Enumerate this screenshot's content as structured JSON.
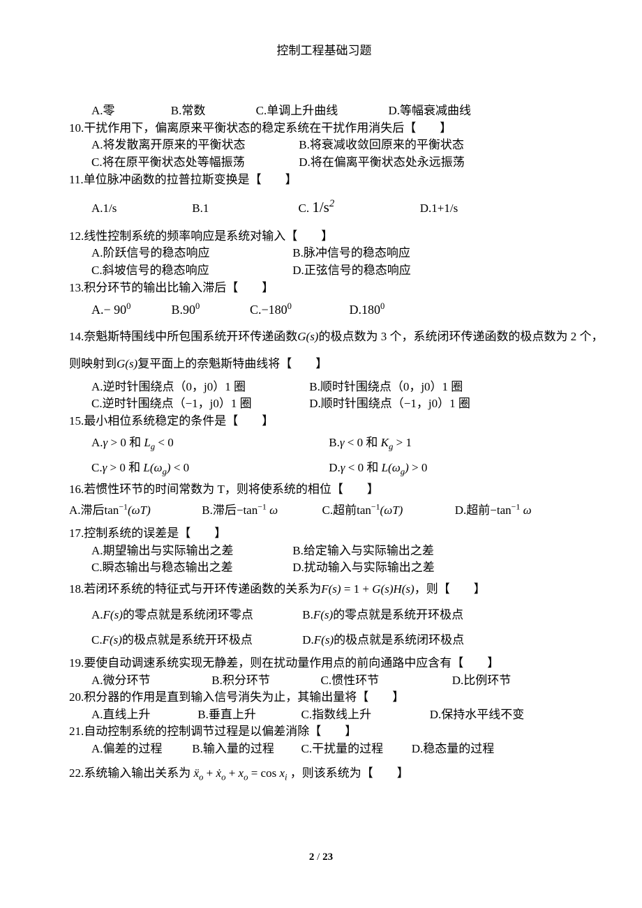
{
  "pageTitle": "控制工程基础习题",
  "footer": {
    "current": "2",
    "sep": " / ",
    "total": "23"
  },
  "q9opts": {
    "a": "A.零",
    "b": "B.常数",
    "c": "C.单调上升曲线",
    "d": "D.等幅衰减曲线"
  },
  "q10": {
    "stem": "10.干扰作用下，偏离原来平衡状态的稳定系统在干扰作用消失后【　　】",
    "a": "A.将发散离开原来的平衡状态",
    "b": "B.将衰减收敛回原来的平衡状态",
    "c": "C.将在原平衡状态处等幅振荡",
    "d": "D.将在偏离平衡状态处永远振荡"
  },
  "q11": {
    "stem": "11.单位脉冲函数的拉普拉斯变换是【　　】",
    "a": "A.1/s",
    "b": "B.1",
    "cPre": "C. ",
    "cFrac": "1/s",
    "cSup": "2",
    "d": "D.1+1/s"
  },
  "q12": {
    "stem": "12.线性控制系统的频率响应是系统对输入【　　】",
    "a": "A.阶跃信号的稳态响应",
    "b": "B.脉冲信号的稳态响应",
    "c": "C.斜坡信号的稳态响应",
    "d": "D.正弦信号的稳态响应"
  },
  "q13": {
    "stem": "13.积分环节的输出比输入滞后【　　】",
    "a": {
      "label": "A.",
      "base": "− 90",
      "sup": "0"
    },
    "b": {
      "label": "B.",
      "base": "90",
      "sup": "0"
    },
    "c": {
      "label": "C.",
      "base": "−180",
      "sup": "0"
    },
    "d": {
      "label": "D.",
      "base": "180",
      "sup": "0"
    }
  },
  "q14": {
    "part1pre": "14.奈魁斯特围线中所包围系统开环传递函数",
    "Gs": "G(s)",
    "part1post": "的极点数为 3 个，系统闭环传递函数的极点数为 2 个，",
    "part2pre": "则映射到",
    "part2post": "复平面上的奈魁斯特曲线将【　　】",
    "a": "A.逆时针围绕点（0，j0）1 圈",
    "b": "B.顺时针围绕点（0，j0）1 圈",
    "c": "C.逆时针围绕点（−1，j0）1 圈",
    "d": "D.顺时针围绕点（−1，j0）1 圈"
  },
  "q15": {
    "stem": "15.最小相位系统稳定的条件是【　　】",
    "a": {
      "pre": "A.",
      "g": "γ",
      "mid": " > 0 和 ",
      "L": "L",
      "sub": "g",
      "post": " < 0"
    },
    "b": {
      "pre": "B.",
      "g": "γ",
      "mid": " < 0 和 ",
      "K": "K",
      "sub": "g",
      "post": " > 1"
    },
    "c": {
      "pre": "C.",
      "g": "γ",
      "mid": " > 0 和 ",
      "L": "L(ω",
      "sub": "g",
      "close": ")",
      "post": " < 0"
    },
    "d": {
      "pre": "D.",
      "g": "γ",
      "mid": " < 0 和 ",
      "L": "L(ω",
      "sub": "g",
      "close": ")",
      "post": " > 0"
    }
  },
  "q16": {
    "stem": "16.若惯性环节的时间常数为 T，则将使系统的相位【　　】",
    "a": {
      "pre": "A.滞后",
      "f": "tan",
      "sup": "−1",
      "arg": "(ωT)"
    },
    "b": {
      "pre": "B.滞后",
      "neg": "−",
      "f": "tan",
      "sup": "−1",
      "arg": " ω"
    },
    "c": {
      "pre": "C.超前",
      "f": "tan",
      "sup": "−1",
      "arg": "(ωT)"
    },
    "d": {
      "pre": "D.超前",
      "neg": "−",
      "f": "tan",
      "sup": "−1",
      "arg": " ω"
    }
  },
  "q17": {
    "stem": "17.控制系统的误差是【　　】",
    "a": "A.期望输出与实际输出之差",
    "b": "B.给定输入与实际输出之差",
    "c": "C.瞬态输出与稳态输出之差",
    "d": "D.扰动输入与实际输出之差"
  },
  "q18": {
    "stemPre": "18.若闭环系统的特征式与开环传递函数的关系为",
    "F": "F(s)",
    "eq": " = 1 + ",
    "G": "G(s)",
    "H": "H(s)",
    "stemPost": "，则【　　】",
    "a": {
      "pre": "A.",
      "post": "的零点就是系统闭环零点"
    },
    "b": {
      "pre": "B.",
      "post": "的零点就是系统开环极点"
    },
    "c": {
      "pre": "C.",
      "post": "的极点就是系统开环极点"
    },
    "d": {
      "pre": "D.",
      "post": "的极点就是系统闭环极点"
    }
  },
  "q19": {
    "stem": "19.要使自动调速系统实现无静差，则在扰动量作用点的前向通路中应含有【　　】",
    "a": "A.微分环节",
    "b": "B.积分环节",
    "c": "C.惯性环节",
    "d": "D.比例环节"
  },
  "q20": {
    "stem": "20.积分器的作用是直到输入信号消失为止，其输出量将【　　】",
    "a": "A.直线上升",
    "b": "B.垂直上升",
    "c": "C.指数线上升",
    "d": "D.保持水平线不变"
  },
  "q21": {
    "stem": "21.自动控制系统的控制调节过程是以偏差消除【　　】",
    "a": "A.偏差的过程",
    "b": "B.输入量的过程",
    "c": "C.干扰量的过程",
    "d": "D.稳态量的过程"
  },
  "q22": {
    "stemPre": "22.系统输入输出关系为",
    "xddot": "ẍ",
    "sub1": "o",
    "plus1": " + ",
    "xdot": "ẋ",
    "sub2": "o",
    "plus2": " + ",
    "x": "x",
    "sub3": "o",
    "eq": " = cos ",
    "xi": "x",
    "sub4": "i",
    "stemPost": "，则该系统为【　　】"
  }
}
